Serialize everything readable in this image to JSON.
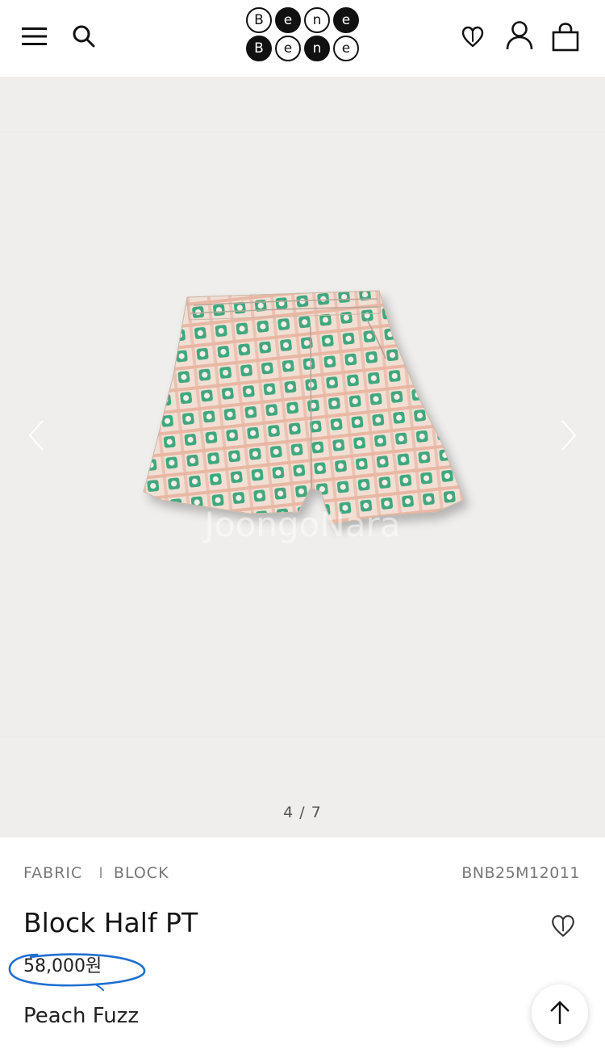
{
  "header": {
    "logo_rows": [
      [
        "B",
        "e",
        "n",
        "e"
      ],
      [
        "B",
        "e",
        "n",
        "e"
      ]
    ],
    "icons": {
      "menu": "menu-icon",
      "search": "search-icon",
      "wishlist": "heart-icon",
      "account": "user-icon",
      "cart": "shopping-bag-icon"
    }
  },
  "gallery": {
    "current": "4",
    "total": "7",
    "counter_text": "4 / 7",
    "watermark": "JoongoNara",
    "image_subject": "patterned shorts"
  },
  "product": {
    "breadcrumb": [
      "FABRIC",
      "BLOCK"
    ],
    "breadcrumb_separator": "I",
    "sku": "BNB25M12011",
    "name": "Block Half PT",
    "price": "58,000원",
    "color": "Peach Fuzz"
  },
  "colors": {
    "background_gallery": "#efeeec",
    "pattern_green": "#3fa77e",
    "pattern_peach": "#e9b7a4",
    "price_annotation": "#1f6fd1"
  }
}
